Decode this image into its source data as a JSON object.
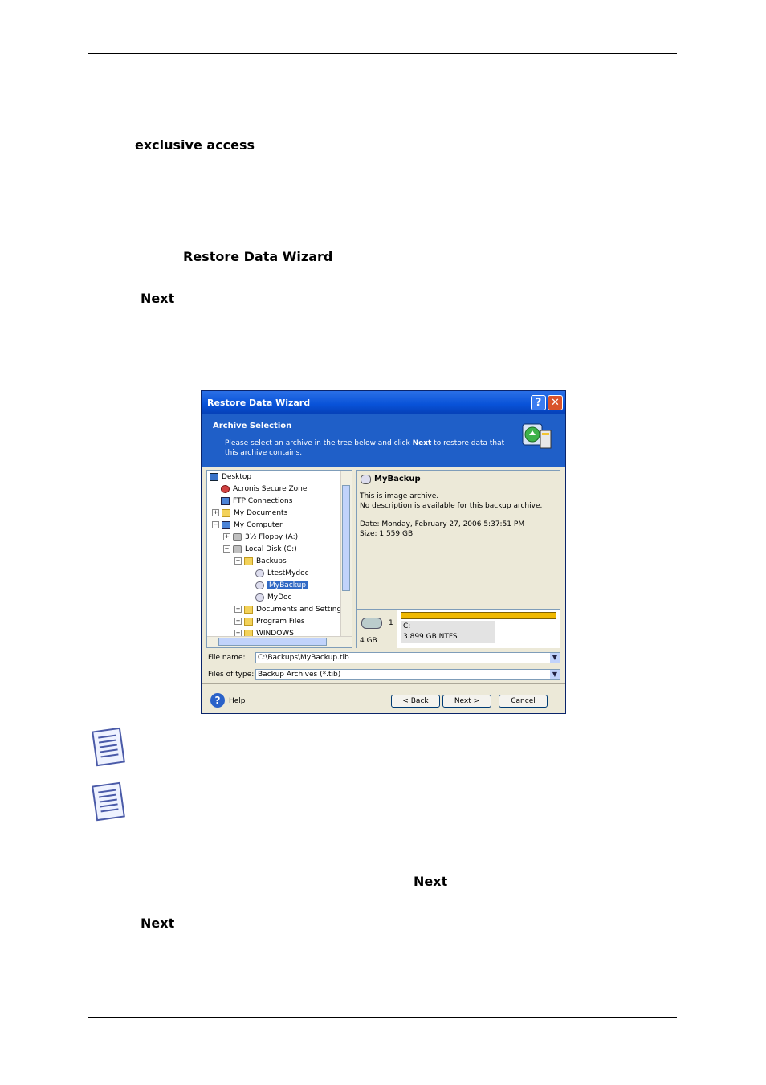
{
  "page_text": {
    "exclusive_access": "exclusive access",
    "restore_data_wizard": "Restore Data Wizard",
    "next_1": "Next",
    "next_2": "Next",
    "next_3": "Next"
  },
  "dialog": {
    "title": "Restore Data Wizard",
    "help_btn": "?",
    "close_btn": "✕",
    "header_title": "Archive Selection",
    "header_desc_pre": "Please select an archive in the tree below and click ",
    "header_desc_bold": "Next",
    "header_desc_post": " to restore data that this archive contains.",
    "tree": [
      {
        "label": "Desktop",
        "icon": "desk"
      },
      {
        "label": "Acronis Secure Zone",
        "icon": "zone"
      },
      {
        "label": "FTP Connections",
        "icon": "comp"
      },
      {
        "label": "My Documents",
        "icon": "folder"
      },
      {
        "label": "My Computer",
        "icon": "comp"
      },
      {
        "label": "3½ Floppy (A:)",
        "icon": "drive"
      },
      {
        "label": "Local Disk (C:)",
        "icon": "drive"
      },
      {
        "label": "Backups",
        "icon": "folder"
      },
      {
        "label": "LtestMydoc",
        "icon": "arch"
      },
      {
        "label": "MyBackup",
        "icon": "arch"
      },
      {
        "label": "MyDoc",
        "icon": "arch"
      },
      {
        "label": "Documents and Setting",
        "icon": "folder"
      },
      {
        "label": "Program Files",
        "icon": "folder"
      },
      {
        "label": "WINDOWS",
        "icon": "folder"
      }
    ],
    "info": {
      "name": "MyBackup",
      "line1": "This is image archive.",
      "line2": "No description is available for this backup archive.",
      "date": "Date: Monday, February 27, 2006 5:37:51 PM",
      "size": "Size: 1.559 GB"
    },
    "disk": {
      "number": "1",
      "size": "4 GB",
      "partition_label": "C:",
      "partition_size": "3.899 GB  NTFS"
    },
    "file_name_label": "File name:",
    "file_name_value": "C:\\Backups\\MyBackup.tib",
    "file_type_label": "Files of type:",
    "file_type_value": "Backup Archives (*.tib)",
    "help_label": "Help",
    "back_btn": "< Back",
    "next_btn": "Next >",
    "cancel_btn": "Cancel"
  }
}
